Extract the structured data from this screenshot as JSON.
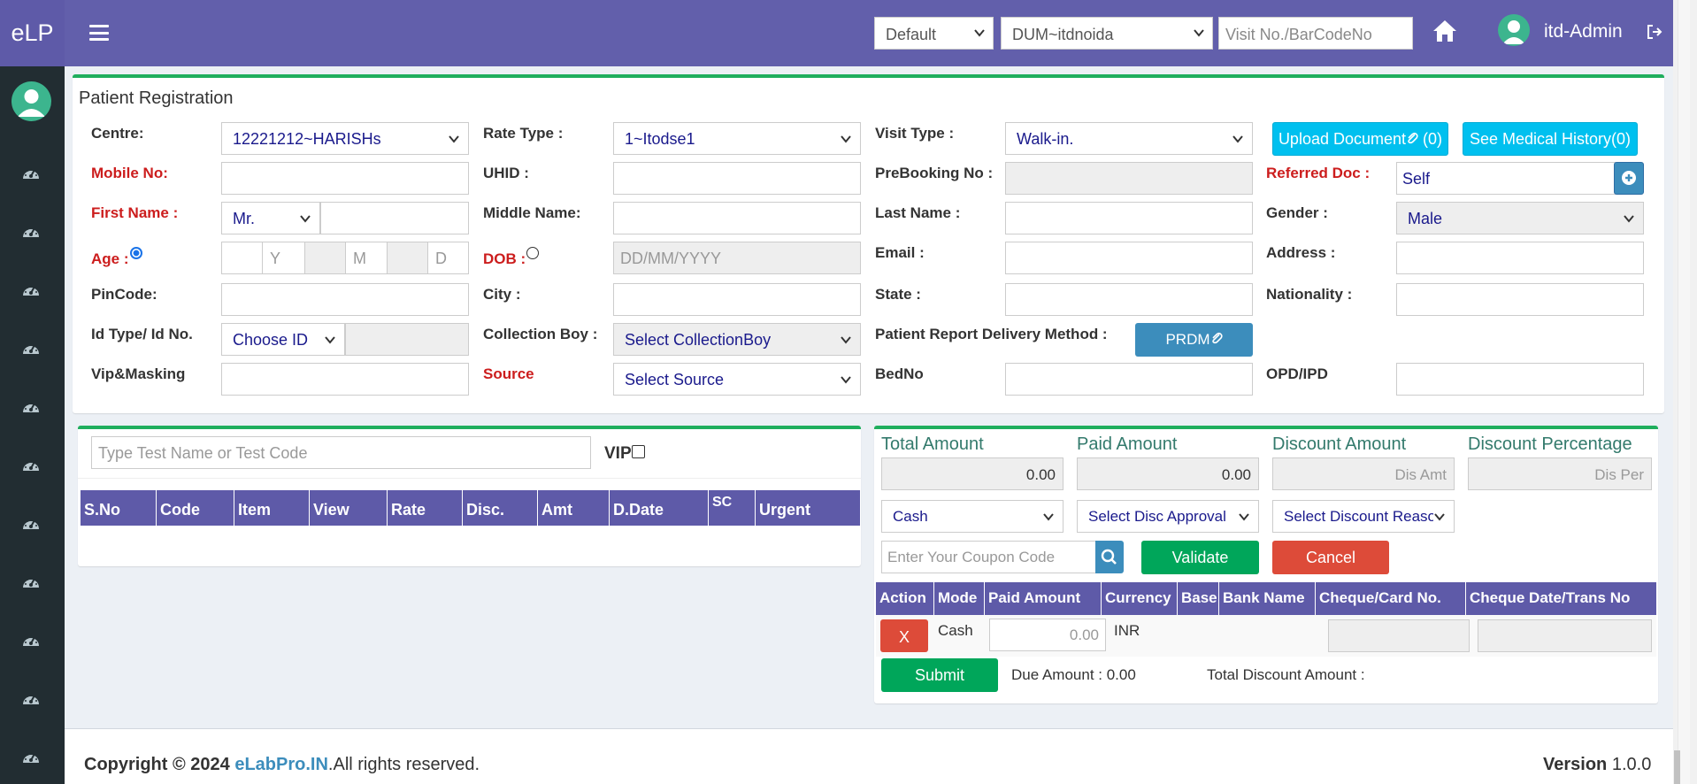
{
  "app": {
    "logo": "eLP"
  },
  "topbar": {
    "profile_select": "Default",
    "centre_select": "DUM~itdnoida",
    "visit_placeholder": "Visit No./BarCodeNo",
    "user_name": "itd-Admin"
  },
  "registration": {
    "title": "Patient Registration",
    "labels": {
      "centre": "Centre:",
      "rate_type": "Rate Type :",
      "visit_type": "Visit Type :",
      "mobile": "Mobile No:",
      "uhid": "UHID :",
      "prebooking": "PreBooking No :",
      "referred_doc": "Referred Doc :",
      "first_name": "First Name :",
      "middle_name": "Middle Name:",
      "last_name": "Last Name :",
      "gender": "Gender :",
      "age": "Age :",
      "dob": "DOB :",
      "email": "Email :",
      "address": "Address :",
      "pincode": "PinCode:",
      "city": "City :",
      "state": "State :",
      "nationality": "Nationality :",
      "id_type": "Id Type/ Id No.",
      "collection_boy": "Collection Boy :",
      "delivery_method": "Patient Report Delivery Method :",
      "vip_masking": "Vip&Masking",
      "source": "Source",
      "bed_no": "BedNo",
      "opd_ipd": "OPD/IPD"
    },
    "values": {
      "centre": "12221212~HARISHs",
      "rate_type": "1~Itodse1",
      "visit_type": "Walk-in.",
      "referred_doc": "Self",
      "title": "Mr.",
      "gender": "Male",
      "id_type": "Choose ID",
      "collection_boy": "Select CollectionBoy",
      "source": "Select Source"
    },
    "placeholders": {
      "age_y": "Y",
      "age_m": "M",
      "age_d": "D",
      "dob": "DD/MM/YYYY"
    },
    "buttons": {
      "upload_document": "Upload Document",
      "upload_count": "(0)",
      "medical_history": "See Medical History(0)",
      "prdm": "PRDM"
    }
  },
  "tests": {
    "search_placeholder": "Type Test Name or Test Code",
    "vip_label": "VIP",
    "columns": [
      "S.No",
      "Code",
      "Item",
      "View",
      "Rate",
      "Disc.",
      "Amt",
      "D.Date",
      "SC",
      "Urgent"
    ]
  },
  "payment": {
    "labels": {
      "total": "Total Amount",
      "paid": "Paid Amount",
      "discount_amount": "Discount Amount",
      "discount_percentage": "Discount Percentage"
    },
    "values": {
      "total": "0.00",
      "paid": "0.00",
      "dis_amt_placeholder": "Dis Amt",
      "dis_per_placeholder": "Dis Per"
    },
    "mode_select": "Cash",
    "disc_approval_select": "Select Disc Approval",
    "disc_reason_select": "Select Discount Reason",
    "coupon_placeholder": "Enter Your Coupon Code",
    "validate": "Validate",
    "cancel": "Cancel",
    "columns": [
      "Action",
      "Mode",
      "Paid Amount",
      "Currency",
      "Base",
      "Bank Name",
      "Cheque/Card No.",
      "Cheque Date/Trans No"
    ],
    "row": {
      "action": "X",
      "mode": "Cash",
      "amount_placeholder": "0.00",
      "currency": "INR"
    },
    "submit": "Submit",
    "due_amount": "Due Amount : 0.00",
    "total_discount": "Total Discount Amount :"
  },
  "footer": {
    "copyright": "Copyright © 2024 ",
    "brand": "eLabPro.IN",
    "rights": ".All rights reserved.",
    "version_label": "Version",
    "version": "1.0.0"
  },
  "colors": {
    "header": "#625fab",
    "sidebar": "#222d32",
    "panel_accent": "#1fae5d",
    "required": "#cc1d1d",
    "table_header": "#5e5aa8"
  }
}
